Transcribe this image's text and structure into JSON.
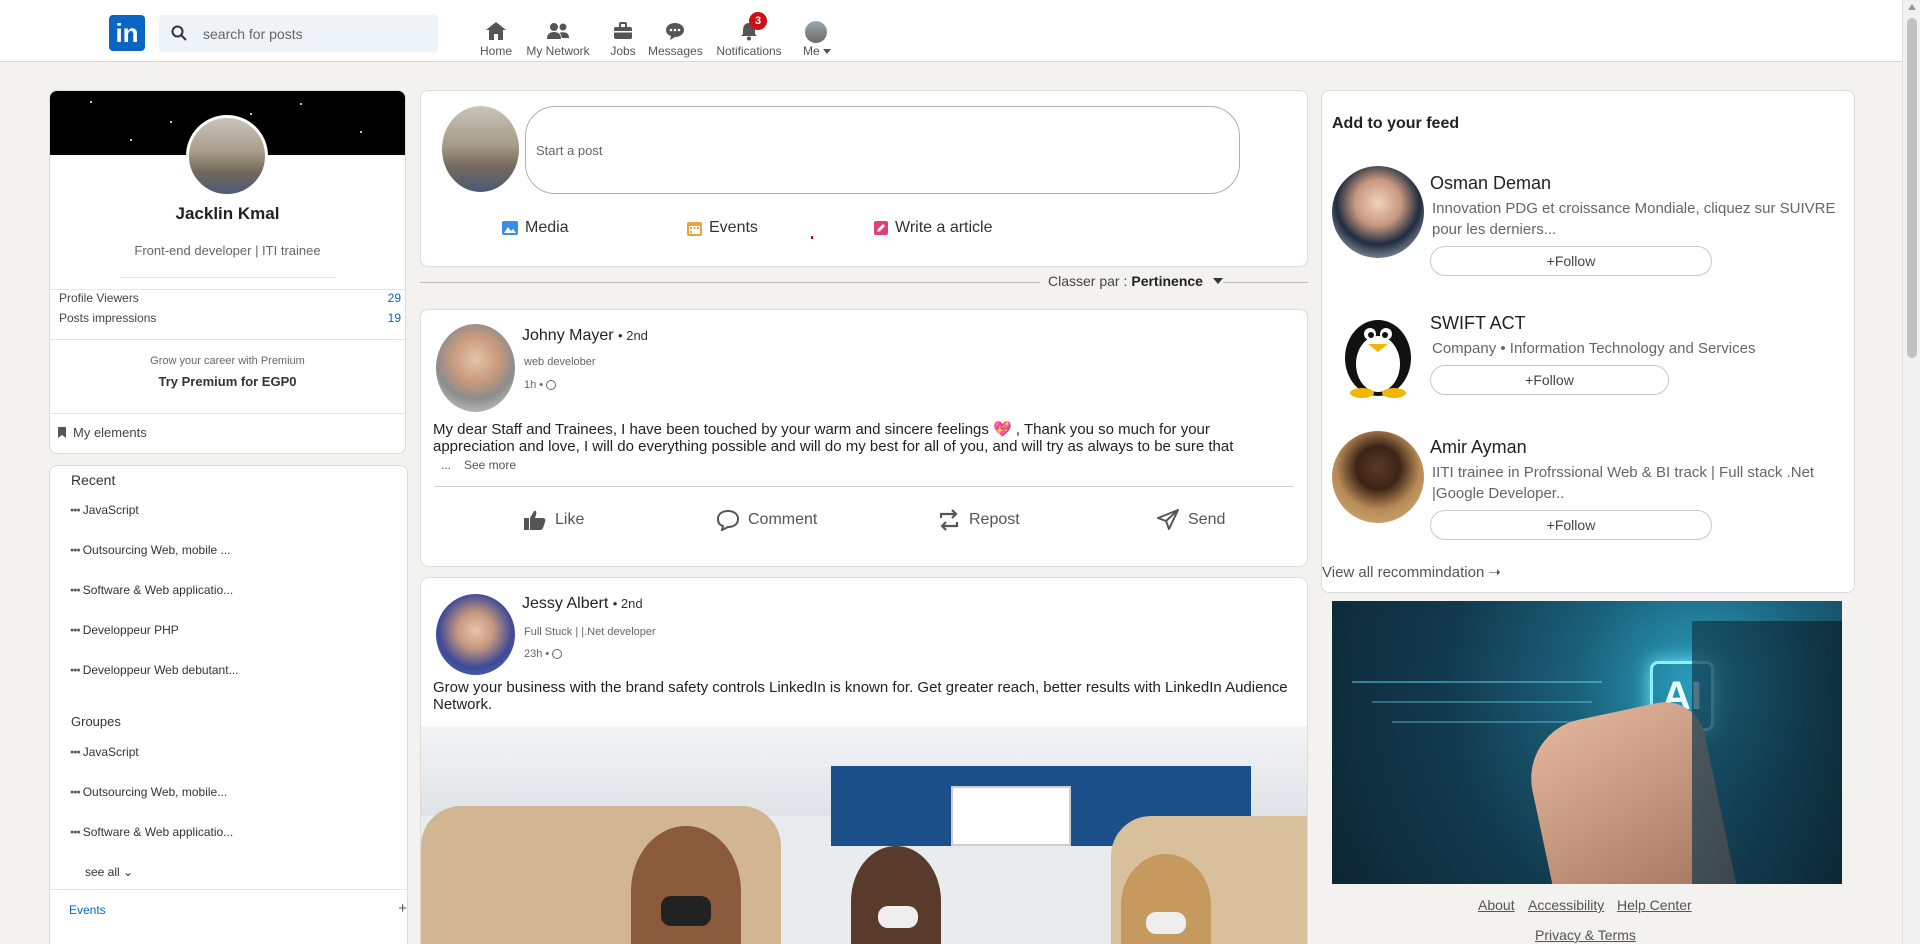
{
  "nav": {
    "logo": "in",
    "search_placeholder": "search for posts",
    "items": [
      {
        "label": "Home",
        "icon": "home-icon"
      },
      {
        "label": "My Network",
        "icon": "network-icon"
      },
      {
        "label": "Jobs",
        "icon": "briefcase-icon"
      },
      {
        "label": "Messages",
        "icon": "chat-icon"
      },
      {
        "label": "Notifications",
        "icon": "bell-icon"
      },
      {
        "label": "Me",
        "icon": "avatar"
      }
    ],
    "notification_count": "3"
  },
  "profile": {
    "name": "Jacklin Kmal",
    "headline": "Front-end developer | ITI trainee",
    "stats": [
      {
        "label": "Profile Viewers",
        "value": "29"
      },
      {
        "label": "Posts impressions",
        "value": "19"
      }
    ],
    "premium_subtitle": "Grow your career with Premium",
    "premium_link": "Try Premium for EGP0",
    "my_elements": "My elements"
  },
  "sidebar": {
    "recent_title": "Recent",
    "recent": [
      "JavaScript",
      "Outsourcing Web, mobile ...",
      "Software & Web applicatio...",
      "Developpeur PHP",
      "Developpeur Web debutant..."
    ],
    "groups_title": "Groupes",
    "groups": [
      "JavaScript",
      "Outsourcing Web, mobile...",
      "Software & Web applicatio..."
    ],
    "see_all": "see all",
    "events": "Events",
    "events_add": "+"
  },
  "composer": {
    "placeholder": "Start a post",
    "buttons": [
      {
        "label": "Media",
        "icon": "image-icon",
        "color": "#378fe9"
      },
      {
        "label": "Events",
        "icon": "calendar-icon",
        "color": "#e7a33e"
      },
      {
        "label": "Write a article",
        "icon": "article-icon",
        "color": "#e06847"
      }
    ]
  },
  "sort": {
    "prefix": "Classer par :",
    "value": "Pertinence"
  },
  "posts": [
    {
      "author": "Johny Mayer",
      "degree": "• 2nd",
      "title": "web develober",
      "time": "1h •",
      "text": "My dear Staff and Trainees, I have been touched by your warm and sincere feelings 💖 , Thank you so much for your appreciation and love, I will do everything possible and will do my best for all of you, and will try as always to be sure that",
      "ellipsis": "...",
      "see_more": "See more",
      "actions": [
        "Like",
        "Comment",
        "Repost",
        "Send"
      ]
    },
    {
      "author": "Jessy Albert",
      "degree": "• 2nd",
      "title": "Full Stuck | |.Net developer",
      "time": "23h •",
      "text": "Grow your business with the brand safety controls LinkedIn is known for. Get greater reach, better results with LinkedIn Audience Network."
    }
  ],
  "feed": {
    "title": "Add to your feed",
    "recommendations": [
      {
        "name": "Osman Deman",
        "desc": "Innovation PDG et croissance Mondiale, cliquez sur SUIVRE pour les derniers...",
        "button": "+Follow"
      },
      {
        "name": "SWIFT ACT",
        "desc": "Company • Information Technology and Services",
        "button": "+Follow"
      },
      {
        "name": "Amir Ayman",
        "desc": "IITI trainee in Profrssional Web & BI track | Full stack .Net |Google Developer..",
        "button": "+Follow"
      }
    ],
    "view_all": "View all recommindation"
  },
  "footer": {
    "links": [
      "About",
      "Accessibility",
      "Help Center",
      "Privacy & Terms"
    ]
  },
  "colors": {
    "brand": "#0a66c2",
    "badge": "#cc1016",
    "background": "#f3f2ef"
  }
}
